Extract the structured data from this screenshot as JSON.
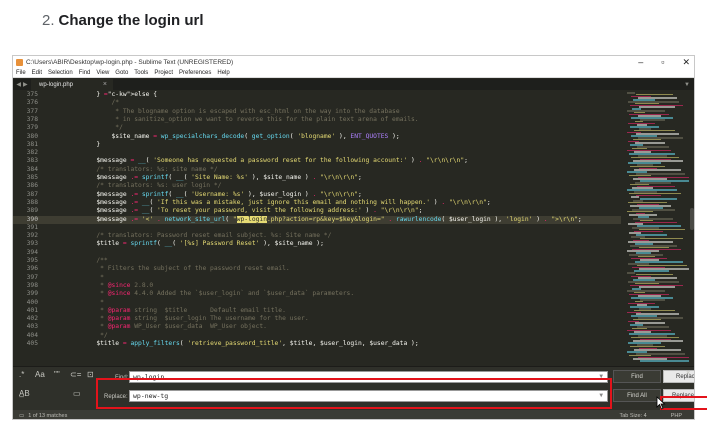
{
  "article": {
    "step_number": "2.",
    "title": "Change the login url"
  },
  "window": {
    "title": "C:\\Users\\ABIR\\Desktop\\wp-login.php - Sublime Text (UNREGISTERED)",
    "controls": {
      "minimize": "–",
      "maximize": "▫",
      "close": "✕"
    }
  },
  "menu": [
    "File",
    "Edit",
    "Selection",
    "Find",
    "View",
    "Goto",
    "Tools",
    "Project",
    "Preferences",
    "Help"
  ],
  "tabs": [
    {
      "label": "wp-login.php",
      "close": "×"
    }
  ],
  "editor": {
    "current_line": "390",
    "lines": [
      {
        "n": "375",
        "t": "        } else {"
      },
      {
        "n": "376",
        "t": "            /*"
      },
      {
        "n": "377",
        "t": "             * The blogname option is escaped with esc_html on the way into the database"
      },
      {
        "n": "378",
        "t": "             * in sanitize_option we want to reverse this for the plain text arena of emails."
      },
      {
        "n": "379",
        "t": "             */"
      },
      {
        "n": "380",
        "t": "            $site_name = wp_specialchars_decode( get_option( 'blogname' ), ENT_QUOTES );"
      },
      {
        "n": "381",
        "t": "        }"
      },
      {
        "n": "382",
        "t": ""
      },
      {
        "n": "383",
        "t": "        $message = __( 'Someone has requested a password reset for the following account:' ) . \"\\r\\n\\r\\n\";"
      },
      {
        "n": "384",
        "t": "        /* translators: %s: site name */"
      },
      {
        "n": "385",
        "t": "        $message .= sprintf( __( 'Site Name: %s' ), $site_name ) . \"\\r\\n\\r\\n\";"
      },
      {
        "n": "386",
        "t": "        /* translators: %s: user login */"
      },
      {
        "n": "387",
        "t": "        $message .= sprintf( __( 'Username: %s' ), $user_login ) . \"\\r\\n\\r\\n\";"
      },
      {
        "n": "388",
        "t": "        $message .= __( 'If this was a mistake, just ignore this email and nothing will happen.' ) . \"\\r\\n\\r\\n\";"
      },
      {
        "n": "389",
        "t": "        $message .= __( 'To reset your password, visit the following address:' ) . \"\\r\\n\\r\\n\";"
      },
      {
        "n": "390",
        "t": "        $message .= '<' . network_site_url( \"wp-login.php?action=rp&key=$key&login=\" . rawurlencode( $user_login ), 'login' ) . \">\\r\\n\";"
      },
      {
        "n": "391",
        "t": ""
      },
      {
        "n": "392",
        "t": "        /* translators: Password reset email subject. %s: Site name */"
      },
      {
        "n": "393",
        "t": "        $title = sprintf( __( '[%s] Password Reset' ), $site_name );"
      },
      {
        "n": "394",
        "t": ""
      },
      {
        "n": "395",
        "t": "        /**"
      },
      {
        "n": "396",
        "t": "         * Filters the subject of the password reset email."
      },
      {
        "n": "397",
        "t": "         *"
      },
      {
        "n": "398",
        "t": "         * @since 2.8.0"
      },
      {
        "n": "399",
        "t": "         * @since 4.4.0 Added the `$user_login` and `$user_data` parameters."
      },
      {
        "n": "400",
        "t": "         *"
      },
      {
        "n": "401",
        "t": "         * @param string  $title      Default email title."
      },
      {
        "n": "402",
        "t": "         * @param string  $user_login The username for the user."
      },
      {
        "n": "403",
        "t": "         * @param WP_User $user_data  WP_User object."
      },
      {
        "n": "404",
        "t": "         */"
      },
      {
        "n": "405",
        "t": "        $title = apply_filters( 'retrieve_password_title', $title, $user_login, $user_data );"
      }
    ],
    "highlight_text": "wp-login"
  },
  "find_panel": {
    "options_row1": [
      ".*",
      "Aa",
      "\"\"",
      "⊂=",
      "⊡"
    ],
    "options_row2": [
      "A̲B",
      "▭"
    ],
    "find_label": "Find:",
    "find_value": "wp-login",
    "replace_label": "Replace:",
    "replace_value": "wp-new-tg",
    "buttons": {
      "find": "Find",
      "find_all": "Find All",
      "replace": "Replace",
      "replace_all": "Replace All"
    },
    "close": "✕"
  },
  "statusbar": {
    "matches": "1 of 13 matches",
    "tab_size": "Tab Size: 4",
    "syntax": "PHP"
  },
  "colors": {
    "editor_bg": "#272822",
    "highlight_border": "#e3131b",
    "match_highlight": "#e6db74"
  }
}
